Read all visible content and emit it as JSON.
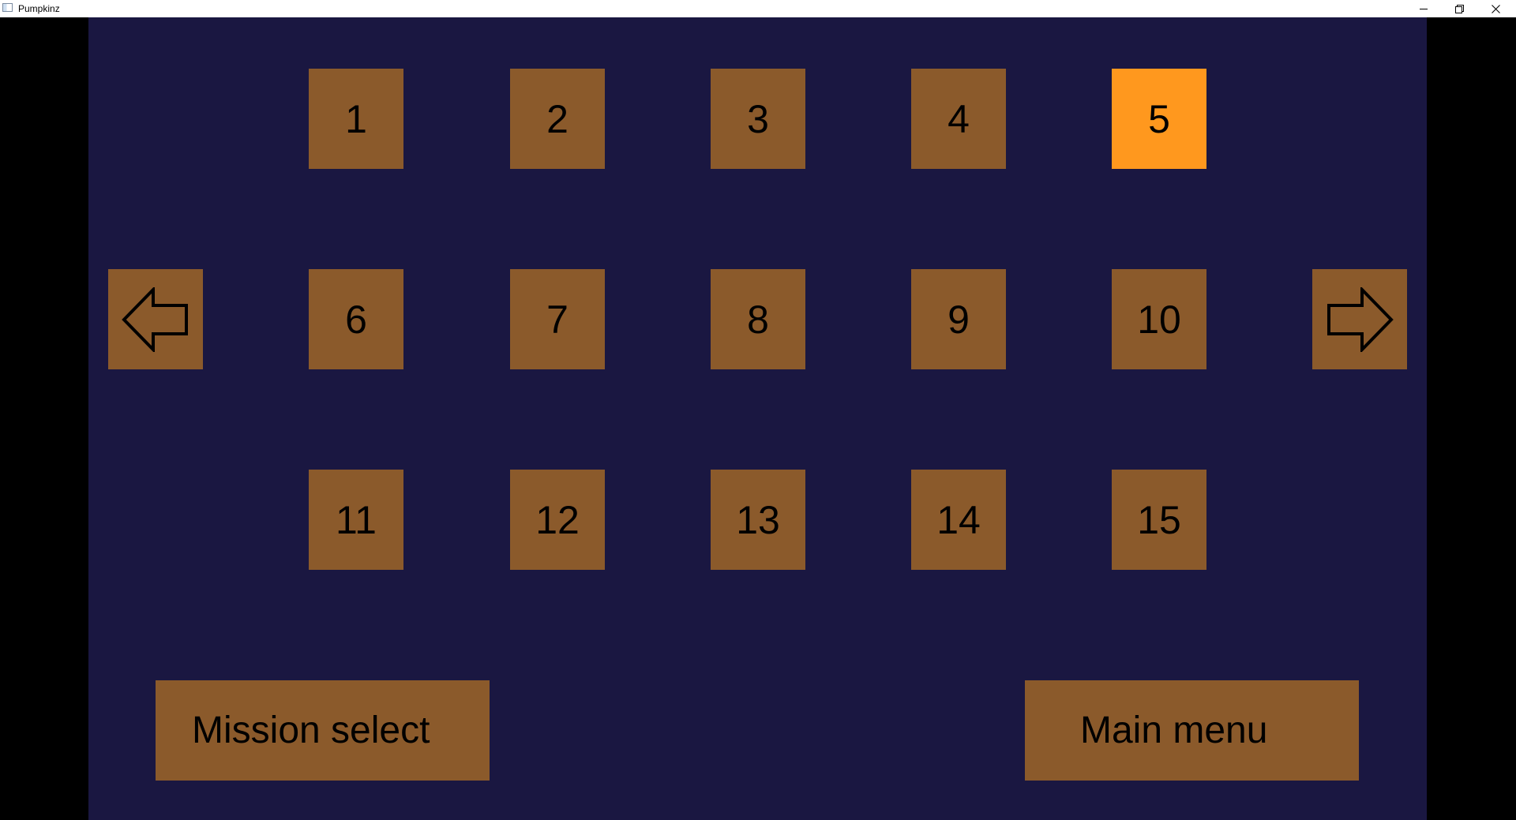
{
  "window": {
    "title": "Pumpkinz"
  },
  "icons": {
    "app": "app-window-icon",
    "minimize": "minimize-icon",
    "restore": "restore-icon",
    "close": "close-icon",
    "prev": "arrow-left-icon",
    "next": "arrow-right-icon"
  },
  "colors": {
    "background": "#1a1741",
    "tile": "#8b5a2b",
    "tile_selected": "#ff981e",
    "text": "#000000"
  },
  "levels": {
    "selected": "5",
    "row1": [
      "1",
      "2",
      "3",
      "4",
      "5"
    ],
    "row2": [
      "6",
      "7",
      "8",
      "9",
      "10"
    ],
    "row3": [
      "11",
      "12",
      "13",
      "14",
      "15"
    ]
  },
  "buttons": {
    "mission_select": "Mission select",
    "main_menu": "Main menu"
  }
}
